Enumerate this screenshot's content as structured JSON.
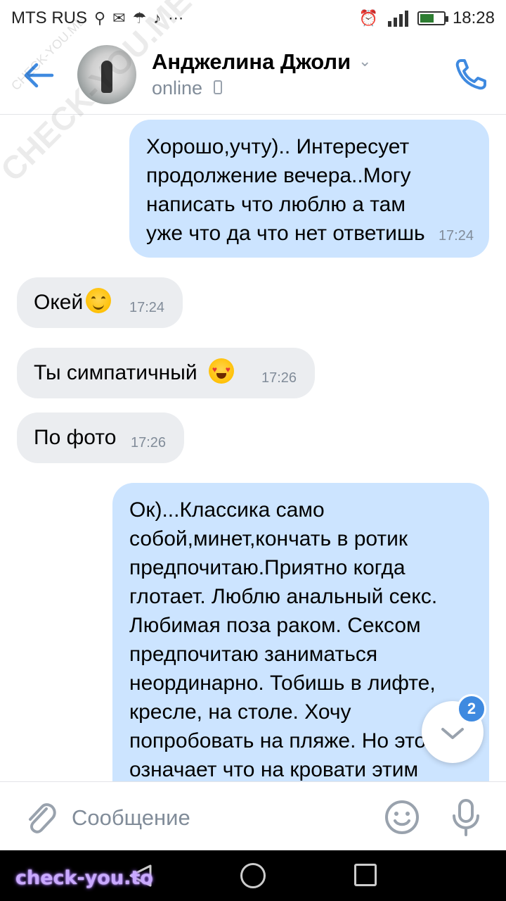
{
  "status_bar": {
    "carrier": "MTS RUS",
    "time": "18:28",
    "icons": [
      "search-icon",
      "mail-icon",
      "weather-icon",
      "tiktok-icon",
      "more-icon",
      "alarm-icon",
      "signal-icon",
      "battery-icon"
    ],
    "battery_level": 0.6
  },
  "header": {
    "contact_name": "Анджелина Джоли",
    "status": "online"
  },
  "messages": [
    {
      "direction": "out",
      "text": "Хорошо,учту).. Интересует продолжение вечера..Могу написать что люблю а там уже что да что нет ответишь",
      "time": "17:24"
    },
    {
      "direction": "in",
      "text": "Окей",
      "emoji": "smiling-face",
      "time": "17:24"
    },
    {
      "direction": "in",
      "text": "Ты симпатичный",
      "emoji": "heart-eyes-face",
      "time": "17:26"
    },
    {
      "direction": "in",
      "text": "По фото",
      "time": "17:26"
    },
    {
      "direction": "out",
      "text": "Ок)...Классика само собой,минет,кончать в ротик предпочитаю.Приятно когда глотает. Люблю анальный секс. Любимая поза раком. Сексом предпочитаю заниматься неординарно. Тобишь в лифте, кресле, на столе. Хочу попробовать на пляже. Но это не означает что на кровати этим"
    }
  ],
  "scroll_button": {
    "badge": "2"
  },
  "compose": {
    "placeholder": "Сообщение"
  },
  "watermarks": {
    "diagonal": "CHECK-YOU.ME",
    "bottom": "check-you.to"
  },
  "colors": {
    "accent": "#3f8ae0",
    "outgoing_bubble": "#cce4ff",
    "incoming_bubble": "#ebedf0",
    "secondary_text": "#818c99"
  }
}
